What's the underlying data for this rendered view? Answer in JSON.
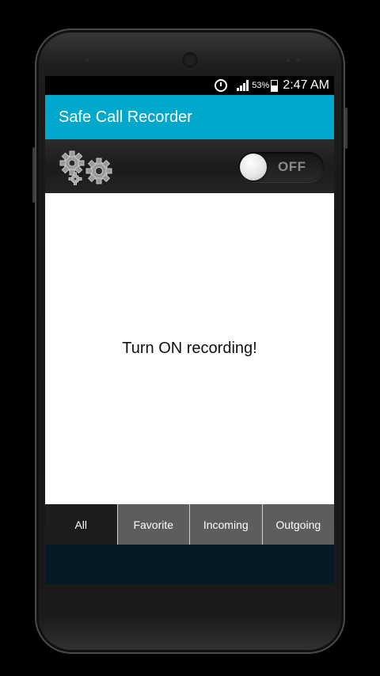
{
  "status_bar": {
    "alarm_icon": "alarm-icon",
    "signal_icon": "signal-icon",
    "battery_percent": "53%",
    "battery_icon": "battery-icon",
    "time": "2:47 AM"
  },
  "app_bar": {
    "title": "Safe Call Recorder"
  },
  "control_bar": {
    "settings_icon": "gears-icon",
    "recording_toggle": {
      "state_label": "OFF",
      "on": false
    }
  },
  "content": {
    "message": "Turn ON recording!"
  },
  "tabs": [
    {
      "label": "All",
      "active": true
    },
    {
      "label": "Favorite",
      "active": false
    },
    {
      "label": "Incoming",
      "active": false
    },
    {
      "label": "Outgoing",
      "active": false
    }
  ],
  "colors": {
    "accent": "#00a9cc",
    "tab_active": "#1d1d1d",
    "tab_inactive": "#5d5d5d"
  }
}
